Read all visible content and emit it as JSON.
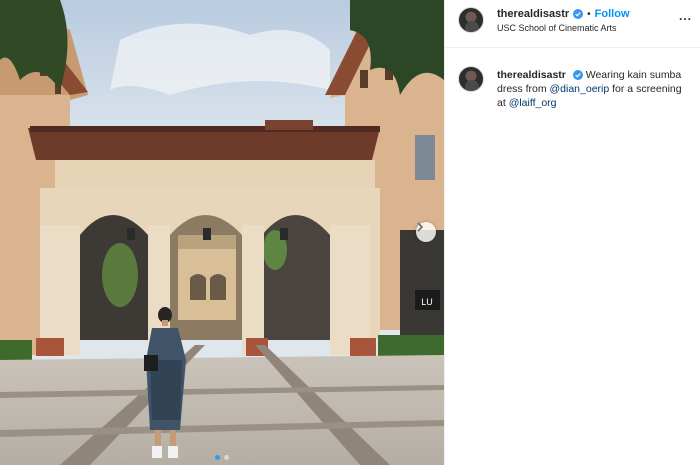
{
  "post": {
    "username": "therealdisastr",
    "follow_label": "Follow",
    "separator": "•",
    "location": "USC School of Cinematic Arts",
    "more_label": "...",
    "caption": {
      "username": "therealdisastr",
      "text_1": "Wearing kain sumba dress from ",
      "mention_1": "@dian_oerip",
      "text_2": " for a screening at ",
      "mention_2": "@laiff_org"
    },
    "photo": {
      "carousel_count": 2,
      "active_index": 0,
      "sign_text": "LU"
    }
  },
  "colors": {
    "follow_blue": "#0095f6",
    "mention_navy": "#00376b",
    "verified_blue": "#3897f0",
    "text": "#262626"
  },
  "icons": [
    "verified-badge-icon",
    "more-options-icon",
    "chevron-right-icon"
  ]
}
